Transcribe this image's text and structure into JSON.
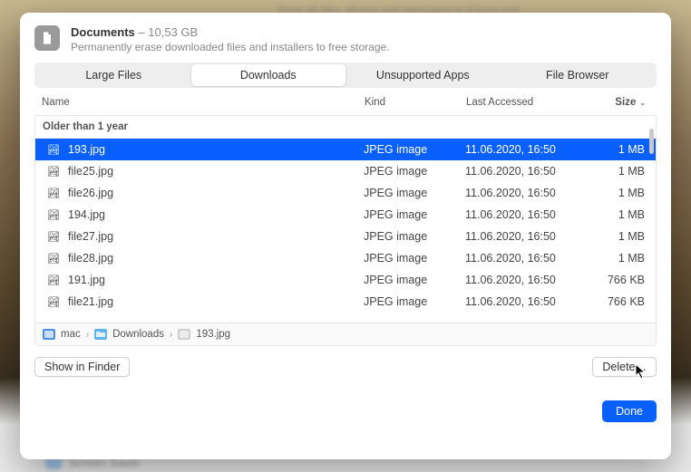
{
  "bg": {
    "top_hint": "Store all files, photos and messages in iCloud and",
    "bottom_item": "Screen Saver"
  },
  "header": {
    "title": "Documents",
    "size": "– 10,53 GB",
    "subtitle": "Permanently erase downloaded files and installers to free storage."
  },
  "tabs": {
    "large_files": "Large Files",
    "downloads": "Downloads",
    "unsupported": "Unsupported Apps",
    "file_browser": "File Browser"
  },
  "columns": {
    "name": "Name",
    "kind": "Kind",
    "last": "Last Accessed",
    "size": "Size"
  },
  "group_header": "Older than 1 year",
  "rows": [
    {
      "name": "193.jpg",
      "kind": "JPEG image",
      "last": "11.06.2020, 16:50",
      "size": "1 MB",
      "selected": true
    },
    {
      "name": "file25.jpg",
      "kind": "JPEG image",
      "last": "11.06.2020, 16:50",
      "size": "1 MB",
      "selected": false
    },
    {
      "name": "file26.jpg",
      "kind": "JPEG image",
      "last": "11.06.2020, 16:50",
      "size": "1 MB",
      "selected": false
    },
    {
      "name": "194.jpg",
      "kind": "JPEG image",
      "last": "11.06.2020, 16:50",
      "size": "1 MB",
      "selected": false
    },
    {
      "name": "file27.jpg",
      "kind": "JPEG image",
      "last": "11.06.2020, 16:50",
      "size": "1 MB",
      "selected": false
    },
    {
      "name": "file28.jpg",
      "kind": "JPEG image",
      "last": "11.06.2020, 16:50",
      "size": "1 MB",
      "selected": false
    },
    {
      "name": "191.jpg",
      "kind": "JPEG image",
      "last": "11.06.2020, 16:50",
      "size": "766 KB",
      "selected": false
    },
    {
      "name": "file21.jpg",
      "kind": "JPEG image",
      "last": "11.06.2020, 16:50",
      "size": "766 KB",
      "selected": false
    }
  ],
  "breadcrumb": {
    "root": "mac",
    "folder": "Downloads",
    "file": "193.jpg"
  },
  "footer": {
    "show_in_finder": "Show in Finder",
    "delete": "Delete…",
    "done": "Done"
  }
}
